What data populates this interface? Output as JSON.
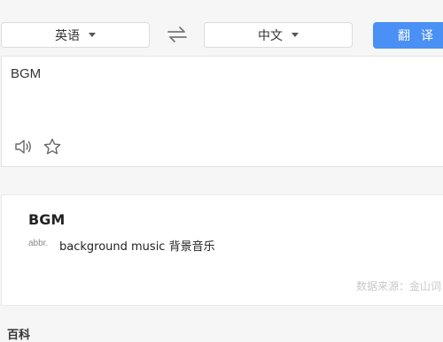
{
  "lang_bar": {
    "source_lang": "英语",
    "target_lang": "中文",
    "swap_icon": "swap-arrows-icon",
    "translate_label": "翻译"
  },
  "input": {
    "text": "BGM",
    "icons": [
      "speaker-icon",
      "star-icon"
    ]
  },
  "result": {
    "word": "BGM",
    "pos": "abbr.",
    "definition": "background music 背景音乐",
    "source_note": "数据来源：金山词"
  },
  "next_section": {
    "title": "百科"
  }
}
